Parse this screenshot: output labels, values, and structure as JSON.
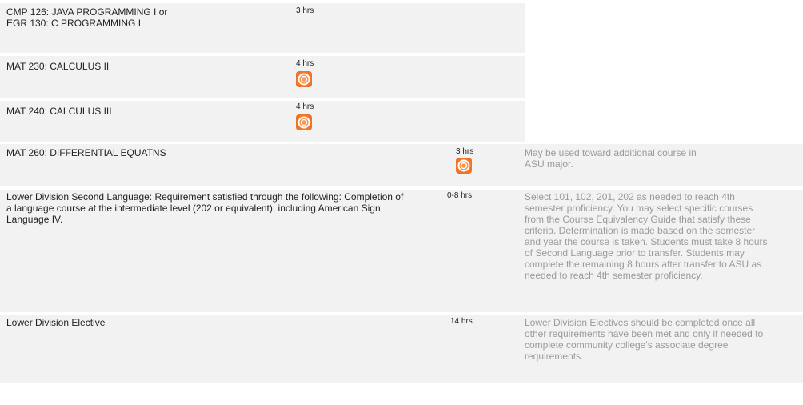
{
  "rows": [
    {
      "title": "CMP 126: JAVA PROGRAMMING I or\nEGR 130: C PROGRAMMING I",
      "hours": "3 hrs",
      "badge": false,
      "note": ""
    },
    {
      "title": "MAT 230: CALCULUS II",
      "hours": "4 hrs",
      "badge": true,
      "badge_icon": "orange-ring-icon",
      "note": ""
    },
    {
      "title": "MAT 240: CALCULUS III",
      "hours": "4 hrs",
      "badge": true,
      "badge_icon": "orange-ring-icon",
      "note": ""
    },
    {
      "title": "MAT 260: DIFFERENTIAL EQUATNS",
      "hours": "3 hrs",
      "badge": true,
      "badge_icon": "orange-ring-icon",
      "note": "May be used toward additional course in ASU major."
    },
    {
      "title": "Lower Division Second Language: Requirement satisfied through the following: Completion of a language course at the intermediate level (202 or equivalent), including American Sign Language IV.",
      "hours": "0-8 hrs",
      "badge": false,
      "note": "Select 101, 102, 201, 202 as needed to reach 4th semester proficiency. You may select specific courses from the Course Equivalency Guide that satisfy these criteria. Determination is made based on the semester and year the course is taken. Students must take 8 hours of Second Language prior to transfer. Students may complete the remaining 8 hours after transfer to ASU as needed to reach 4th semester proficiency."
    },
    {
      "title": "Lower Division Elective",
      "hours": "14 hrs",
      "badge": false,
      "note": "Lower Division Electives should be completed once all other requirements have been met and only if needed to complete community college's associate degree requirements."
    }
  ],
  "colors": {
    "row_bg": "#f2f2f2",
    "note_text": "#9a9a9a",
    "badge": "#f27a2a"
  }
}
